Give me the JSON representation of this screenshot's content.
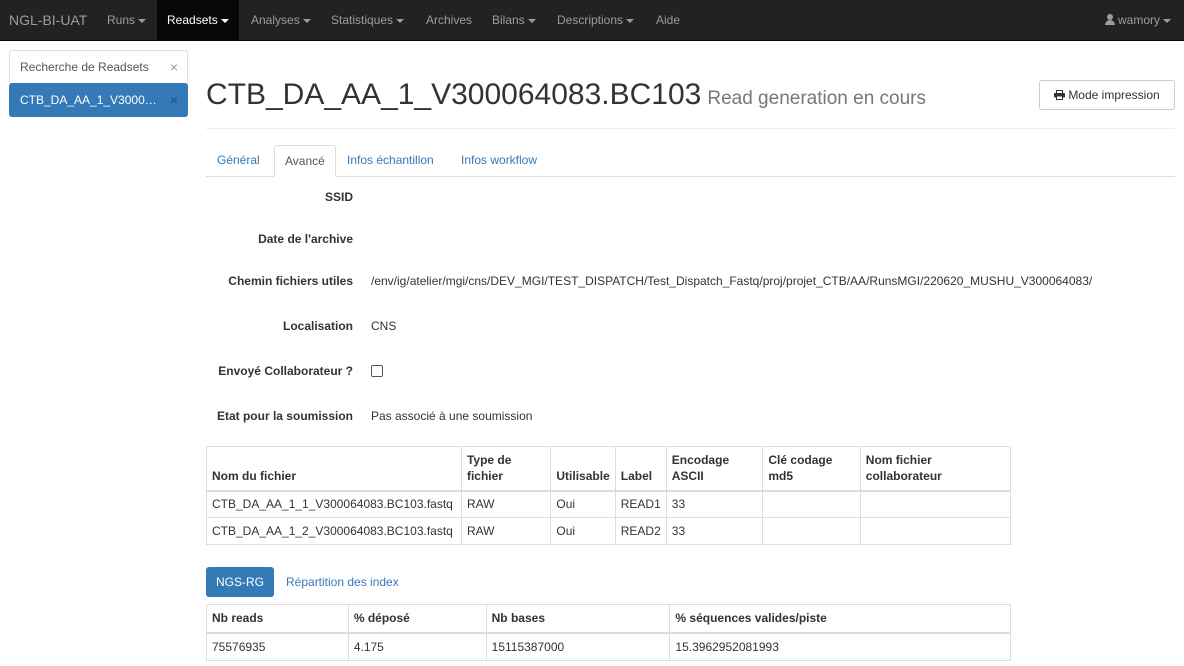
{
  "navbar": {
    "brand": "NGL-BI-UAT",
    "items": [
      {
        "label": "Runs"
      },
      {
        "label": "Readsets"
      },
      {
        "label": "Analyses"
      },
      {
        "label": "Statistiques"
      },
      {
        "label": "Archives"
      },
      {
        "label": "Bilans"
      },
      {
        "label": "Descriptions"
      },
      {
        "label": "Aide"
      }
    ],
    "user": "wamory"
  },
  "sidebar": {
    "tabs": [
      {
        "label": "Recherche de Readsets",
        "close": "×"
      },
      {
        "label": "CTB_DA_AA_1_V300064083.BC103",
        "close": "×"
      }
    ]
  },
  "header": {
    "title": "CTB_DA_AA_1_V300064083.BC103",
    "subtitle": "Read generation en cours",
    "print_button": "Mode impression",
    "print_icon": "printer-icon"
  },
  "tabs": [
    {
      "label": "Général"
    },
    {
      "label": "Avancé"
    },
    {
      "label": "Infos échantillon"
    },
    {
      "label": "Infos workflow"
    }
  ],
  "details": {
    "ssid_label": "SSID",
    "ssid_value": "",
    "archive_date_label": "Date de l'archive",
    "archive_date_value": "",
    "path_label": "Chemin fichiers utiles",
    "path_value": "/env/ig/atelier/mgi/cns/DEV_MGI/TEST_DISPATCH/Test_Dispatch_Fastq/proj/projet_CTB/AA/RunsMGI/220620_MUSHU_V300064083/",
    "location_label": "Localisation",
    "location_value": "CNS",
    "collab_label": "Envoyé Collaborateur ?",
    "collab_checked": false,
    "submission_label": "Etat pour la soumission",
    "submission_value": "Pas associé à une soumission"
  },
  "files_table": {
    "headers": [
      "Nom du fichier",
      "Type de fichier",
      "Utilisable",
      "Label",
      "Encodage ASCII",
      "Clé codage md5",
      "Nom fichier collaborateur"
    ],
    "rows": [
      [
        "CTB_DA_AA_1_1_V300064083.BC103.fastq",
        "RAW",
        "Oui",
        "READ1",
        "33",
        "",
        ""
      ],
      [
        "CTB_DA_AA_1_2_V300064083.BC103.fastq",
        "RAW",
        "Oui",
        "READ2",
        "33",
        "",
        ""
      ]
    ]
  },
  "subtabs": {
    "active": "NGS-RG",
    "other": "Répartition des index"
  },
  "stats_table": {
    "headers": [
      "Nb reads",
      "% déposé",
      "Nb bases",
      "% séquences valides/piste"
    ],
    "rows": [
      [
        "75576935",
        "4.175",
        "15115387000",
        "15.3962952081993"
      ]
    ]
  }
}
